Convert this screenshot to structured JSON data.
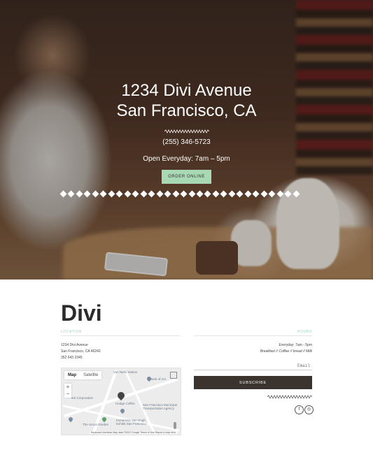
{
  "hero": {
    "title": "1234 Divi Avenue\nSan Francisco, CA",
    "phone": "(255) 346-5723",
    "hours": "Open Everyday: 7am – 5pm",
    "cta_label": "ORDER ONLINE",
    "cta_color": "#a9d8b4"
  },
  "brand": "Divi",
  "location": {
    "label": "LOCATION",
    "lines": [
      "1234 Divi Avenue",
      "San Francisco, CA 46242",
      "352 643 2345"
    ]
  },
  "hours_section": {
    "label": "HOURS",
    "lines": [
      "Everyday: 7am - 5pm",
      "Breakfast // Coffee // bread // Milk"
    ]
  },
  "map": {
    "tab_map": "Map",
    "tab_satellite": "Satellite",
    "zoom_in": "+",
    "zoom_out": "−",
    "places": [
      "Van Ness Station",
      "Bank of Am",
      "Hodge Coffee",
      "San Francisco Municipal Transportation Agency",
      "Immersive Van Gogh Exhibit San Francisco",
      "The Uncut Garden",
      "ark Corporation"
    ],
    "attribution": "Keyboard shortcuts   Map data ©2022 Google   Terms of Use   Report a map error"
  },
  "newsletter": {
    "email_placeholder": "Email",
    "subscribe_label": "SUBSCRIBE",
    "button_color": "#3a332e"
  },
  "social": {
    "facebook_icon": "f",
    "instagram_icon": "◎"
  },
  "accent_color": "#9fd1c0"
}
